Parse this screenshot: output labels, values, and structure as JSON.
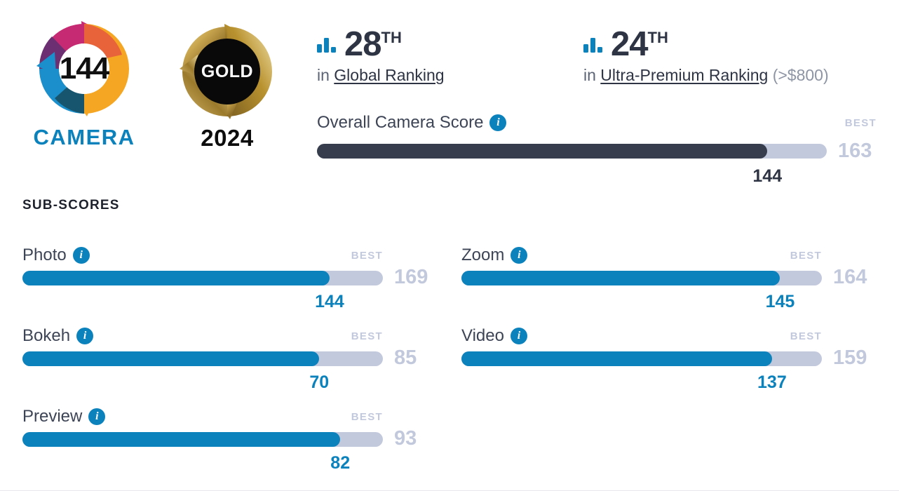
{
  "logo": {
    "score": "144",
    "word": "CAMERA",
    "ring_colors": {
      "magenta": "#c62a72",
      "purple": "#6b2f72",
      "orange": "#e8633a",
      "amber": "#f5a623",
      "blue": "#1b8fcb",
      "teal": "#17556e"
    }
  },
  "award": {
    "label": "GOLD",
    "year": "2024",
    "gold_light": "#e8cf8a",
    "gold_mid": "#c4a04a",
    "gold_dark": "#8a6d28"
  },
  "rankings": [
    {
      "icon": "bar-chart-icon",
      "position": "28",
      "suffix": "TH",
      "prefix": "in",
      "link_label": "Global Ranking",
      "note": ""
    },
    {
      "icon": "bar-chart-icon",
      "position": "24",
      "suffix": "TH",
      "prefix": "in",
      "link_label": "Ultra-Premium Ranking",
      "note": "(>$800)"
    }
  ],
  "overall": {
    "label": "Overall Camera Score",
    "info_icon": "info-icon",
    "best_word": "BEST",
    "value": "144",
    "best": "163",
    "fill_color": "#373d4d",
    "track_color": "#c3c9dd"
  },
  "subscores": {
    "section_title": "SUB-SCORES",
    "best_word": "BEST",
    "accent_color": "#0c82bd",
    "track_color": "#c3c9dd",
    "items": [
      {
        "label": "Photo",
        "value": "144",
        "best": "169",
        "column": "left",
        "row": 0
      },
      {
        "label": "Bokeh",
        "value": "70",
        "best": "85",
        "column": "left",
        "row": 1
      },
      {
        "label": "Preview",
        "value": "82",
        "best": "93",
        "column": "left",
        "row": 2
      },
      {
        "label": "Zoom",
        "value": "145",
        "best": "164",
        "column": "right",
        "row": 0
      },
      {
        "label": "Video",
        "value": "137",
        "best": "159",
        "column": "right",
        "row": 1
      }
    ]
  },
  "chart_data": {
    "type": "bar",
    "title": "DXOMARK Camera Score Card",
    "orientation": "horizontal",
    "categories": [
      "Overall Camera Score",
      "Photo",
      "Bokeh",
      "Preview",
      "Zoom",
      "Video"
    ],
    "series": [
      {
        "name": "Score",
        "values": [
          144,
          144,
          70,
          82,
          145,
          137
        ]
      },
      {
        "name": "Best",
        "values": [
          163,
          169,
          85,
          93,
          164,
          159
        ]
      }
    ],
    "xlabel": "",
    "ylabel": "",
    "legend": [
      "Score",
      "Best"
    ],
    "grid": false
  }
}
